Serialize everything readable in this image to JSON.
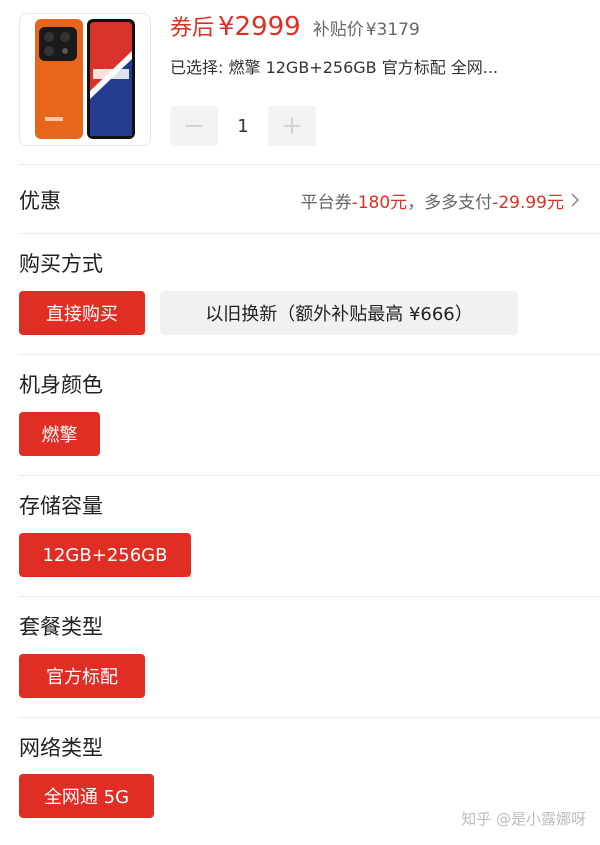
{
  "product": {
    "image_icon": "orange-phone-image",
    "price_label": "券后",
    "price": "¥2999",
    "subsidy_label": "补贴价",
    "subsidy_price": "¥3179",
    "selected_text": "已选择: 燃擎 12GB+256GB 官方标配 全网...",
    "quantity": "1",
    "minus_icon": "minus-icon",
    "plus_icon": "plus-icon"
  },
  "promo": {
    "title": "优惠",
    "coupon_label": "平台券",
    "coupon_value": "-180元",
    "separator": "，",
    "pay_label": "多多支付",
    "pay_value": "-29.99元",
    "chevron_icon": "chevron-right-icon"
  },
  "purchase": {
    "title": "购买方式",
    "options": [
      "直接购买",
      "以旧换新（额外补贴最高 ¥666）"
    ],
    "selected": "直接购买"
  },
  "color": {
    "title": "机身颜色",
    "options": [
      "燃擎"
    ],
    "selected": "燃擎"
  },
  "storage": {
    "title": "存储容量",
    "options": [
      "12GB+256GB"
    ],
    "selected": "12GB+256GB"
  },
  "package": {
    "title": "套餐类型",
    "options": [
      "官方标配"
    ],
    "selected": "官方标配"
  },
  "network": {
    "title": "网络类型",
    "options": [
      "全网通 5G"
    ],
    "selected": "全网通 5G"
  },
  "watermark": "知乎 @是小露娜呀",
  "colors": {
    "accent": "#e02e24",
    "chip_unselected": "#f1f1f1",
    "divider": "#ececec"
  }
}
